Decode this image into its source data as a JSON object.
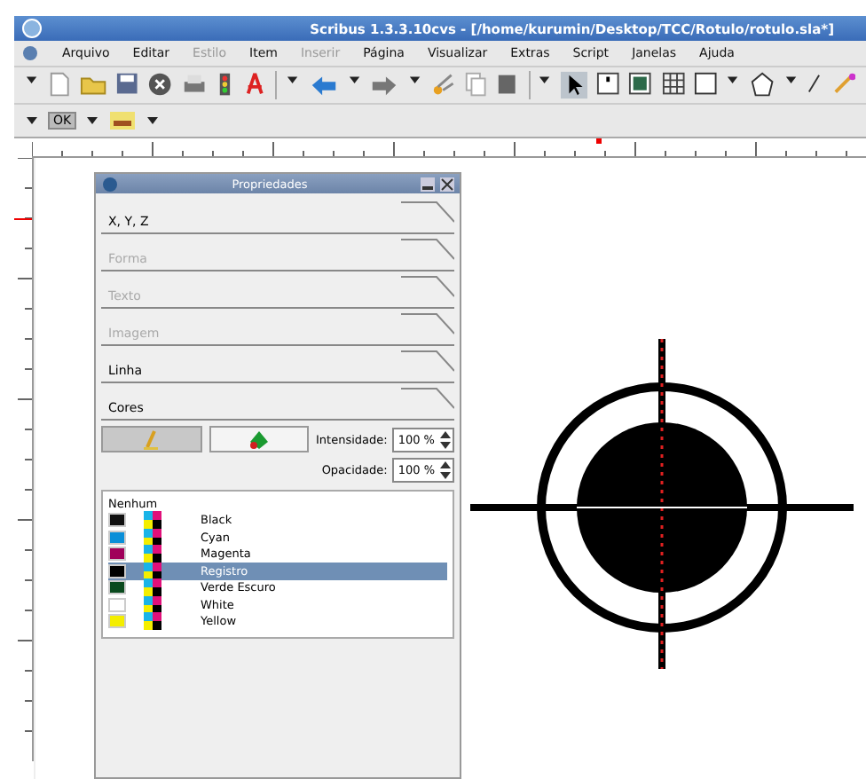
{
  "window": {
    "title": "Scribus 1.3.3.10cvs - [/home/kurumin/Desktop/TCC/Rotulo/rotulo.sla*]"
  },
  "menu": [
    {
      "label": "Arquivo",
      "disabled": false
    },
    {
      "label": "Editar",
      "disabled": false
    },
    {
      "label": "Estilo",
      "disabled": true
    },
    {
      "label": "Item",
      "disabled": false
    },
    {
      "label": "Inserir",
      "disabled": true
    },
    {
      "label": "Página",
      "disabled": false
    },
    {
      "label": "Visualizar",
      "disabled": false
    },
    {
      "label": "Extras",
      "disabled": false
    },
    {
      "label": "Script",
      "disabled": false
    },
    {
      "label": "Janelas",
      "disabled": false
    },
    {
      "label": "Ajuda",
      "disabled": false
    }
  ],
  "toolbar2": {
    "preflight": "OK"
  },
  "properties": {
    "title": "Propriedades",
    "sections": [
      {
        "label": "X, Y, Z",
        "disabled": false
      },
      {
        "label": "Forma",
        "disabled": true
      },
      {
        "label": "Texto",
        "disabled": true
      },
      {
        "label": "Imagem",
        "disabled": true
      },
      {
        "label": "Linha",
        "disabled": false
      },
      {
        "label": "Cores",
        "disabled": false
      }
    ],
    "fields": [
      {
        "label": "Intensidade:",
        "value": "100 %"
      },
      {
        "label": "Opacidade:",
        "value": "100 %"
      }
    ],
    "colors": [
      {
        "name": "Nenhum",
        "kind": "none",
        "selected": false
      },
      {
        "name": "Black",
        "kind": "swatch",
        "color": "#111111",
        "selected": false
      },
      {
        "name": "Cyan",
        "kind": "swatch",
        "color": "#0a8fd8",
        "selected": false
      },
      {
        "name": "Magenta",
        "kind": "swatch",
        "color": "#a0005a",
        "selected": false
      },
      {
        "name": "Registro",
        "kind": "swatch",
        "color": "#000000",
        "selected": true
      },
      {
        "name": "Verde Escuro",
        "kind": "swatch",
        "color": "#0a4a1e",
        "selected": false
      },
      {
        "name": "White",
        "kind": "swatch",
        "color": "#ffffff",
        "selected": false
      },
      {
        "name": "Yellow",
        "kind": "swatch",
        "color": "#f4ee00",
        "selected": false
      }
    ]
  }
}
